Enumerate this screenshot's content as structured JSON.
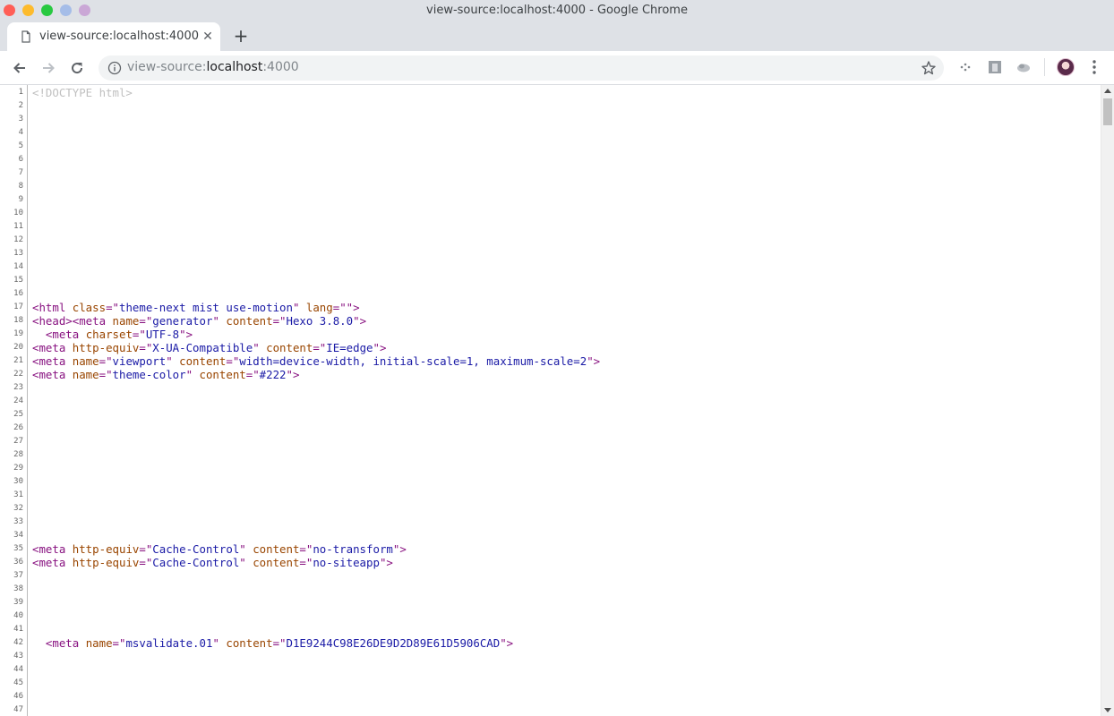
{
  "window": {
    "title": "view-source:localhost:4000 - Google Chrome"
  },
  "tab": {
    "title": "view-source:localhost:4000",
    "close_label": "✕",
    "new_tab_label": "+"
  },
  "omnibox": {
    "url_prefix": "view-source:",
    "url_host": "localhost",
    "url_port": ":4000"
  },
  "toolbar_icons": [
    "back-arrow-icon",
    "forward-arrow-icon",
    "reload-icon",
    "info-icon",
    "star-icon",
    "extension-icons",
    "avatar",
    "more-vert-icon"
  ],
  "colors": {
    "tag": "#881280",
    "attribute": "#994500",
    "value": "#1a1aa6",
    "doctype": "#c0c0c0",
    "line_number": "#666666"
  },
  "source_lines": [
    {
      "n": "1",
      "html": "<span class=\"doctype\">&lt;!DOCTYPE html&gt;</span>"
    },
    {
      "n": "2",
      "html": ""
    },
    {
      "n": "3",
      "html": ""
    },
    {
      "n": "4",
      "html": ""
    },
    {
      "n": "5",
      "html": ""
    },
    {
      "n": "6",
      "html": ""
    },
    {
      "n": "7",
      "html": ""
    },
    {
      "n": "8",
      "html": ""
    },
    {
      "n": "9",
      "html": ""
    },
    {
      "n": "10",
      "html": ""
    },
    {
      "n": "11",
      "html": ""
    },
    {
      "n": "12",
      "html": ""
    },
    {
      "n": "13",
      "html": ""
    },
    {
      "n": "14",
      "html": ""
    },
    {
      "n": "15",
      "html": ""
    },
    {
      "n": "16",
      "html": ""
    },
    {
      "n": "17",
      "html": "<span class=\"tag\">&lt;html </span><span class=\"attr\">class</span><span class=\"tag\">=\"</span><span class=\"val\">theme-next mist use-motion</span><span class=\"tag\">\" </span><span class=\"attr\">lang</span><span class=\"tag\">=\"\"&gt;</span>"
    },
    {
      "n": "18",
      "html": "<span class=\"tag\">&lt;head&gt;&lt;meta </span><span class=\"attr\">name</span><span class=\"tag\">=\"</span><span class=\"val\">generator</span><span class=\"tag\">\" </span><span class=\"attr\">content</span><span class=\"tag\">=\"</span><span class=\"val\">Hexo 3.8.0</span><span class=\"tag\">\"&gt;</span>"
    },
    {
      "n": "19",
      "html": "  <span class=\"tag\">&lt;meta </span><span class=\"attr\">charset</span><span class=\"tag\">=\"</span><span class=\"val\">UTF-8</span><span class=\"tag\">\"&gt;</span>"
    },
    {
      "n": "20",
      "html": "<span class=\"tag\">&lt;meta </span><span class=\"attr\">http-equiv</span><span class=\"tag\">=\"</span><span class=\"val\">X-UA-Compatible</span><span class=\"tag\">\" </span><span class=\"attr\">content</span><span class=\"tag\">=\"</span><span class=\"val\">IE=edge</span><span class=\"tag\">\"&gt;</span>"
    },
    {
      "n": "21",
      "html": "<span class=\"tag\">&lt;meta </span><span class=\"attr\">name</span><span class=\"tag\">=\"</span><span class=\"val\">viewport</span><span class=\"tag\">\" </span><span class=\"attr\">content</span><span class=\"tag\">=\"</span><span class=\"val\">width=device-width, initial-scale=1, maximum-scale=2</span><span class=\"tag\">\"&gt;</span>"
    },
    {
      "n": "22",
      "html": "<span class=\"tag\">&lt;meta </span><span class=\"attr\">name</span><span class=\"tag\">=\"</span><span class=\"val\">theme-color</span><span class=\"tag\">\" </span><span class=\"attr\">content</span><span class=\"tag\">=\"</span><span class=\"val\">#222</span><span class=\"tag\">\"&gt;</span>"
    },
    {
      "n": "23",
      "html": ""
    },
    {
      "n": "24",
      "html": ""
    },
    {
      "n": "25",
      "html": ""
    },
    {
      "n": "26",
      "html": ""
    },
    {
      "n": "27",
      "html": ""
    },
    {
      "n": "28",
      "html": ""
    },
    {
      "n": "29",
      "html": ""
    },
    {
      "n": "30",
      "html": ""
    },
    {
      "n": "31",
      "html": ""
    },
    {
      "n": "32",
      "html": ""
    },
    {
      "n": "33",
      "html": ""
    },
    {
      "n": "34",
      "html": ""
    },
    {
      "n": "35",
      "html": "<span class=\"tag\">&lt;meta </span><span class=\"attr\">http-equiv</span><span class=\"tag\">=\"</span><span class=\"val\">Cache-Control</span><span class=\"tag\">\" </span><span class=\"attr\">content</span><span class=\"tag\">=\"</span><span class=\"val\">no-transform</span><span class=\"tag\">\"&gt;</span>"
    },
    {
      "n": "36",
      "html": "<span class=\"tag\">&lt;meta </span><span class=\"attr\">http-equiv</span><span class=\"tag\">=\"</span><span class=\"val\">Cache-Control</span><span class=\"tag\">\" </span><span class=\"attr\">content</span><span class=\"tag\">=\"</span><span class=\"val\">no-siteapp</span><span class=\"tag\">\"&gt;</span>"
    },
    {
      "n": "37",
      "html": ""
    },
    {
      "n": "38",
      "html": ""
    },
    {
      "n": "39",
      "html": ""
    },
    {
      "n": "40",
      "html": ""
    },
    {
      "n": "41",
      "html": ""
    },
    {
      "n": "42",
      "html": "  <span class=\"tag\">&lt;meta </span><span class=\"attr\">name</span><span class=\"tag\">=\"</span><span class=\"val\">msvalidate.01</span><span class=\"tag\">\" </span><span class=\"attr\">content</span><span class=\"tag\">=\"</span><span class=\"val\">D1E9244C98E26DE9D2D89E61D5906CAD</span><span class=\"tag\">\"&gt;</span>"
    },
    {
      "n": "43",
      "html": ""
    },
    {
      "n": "44",
      "html": ""
    },
    {
      "n": "45",
      "html": ""
    },
    {
      "n": "46",
      "html": ""
    },
    {
      "n": "47",
      "html": ""
    }
  ]
}
